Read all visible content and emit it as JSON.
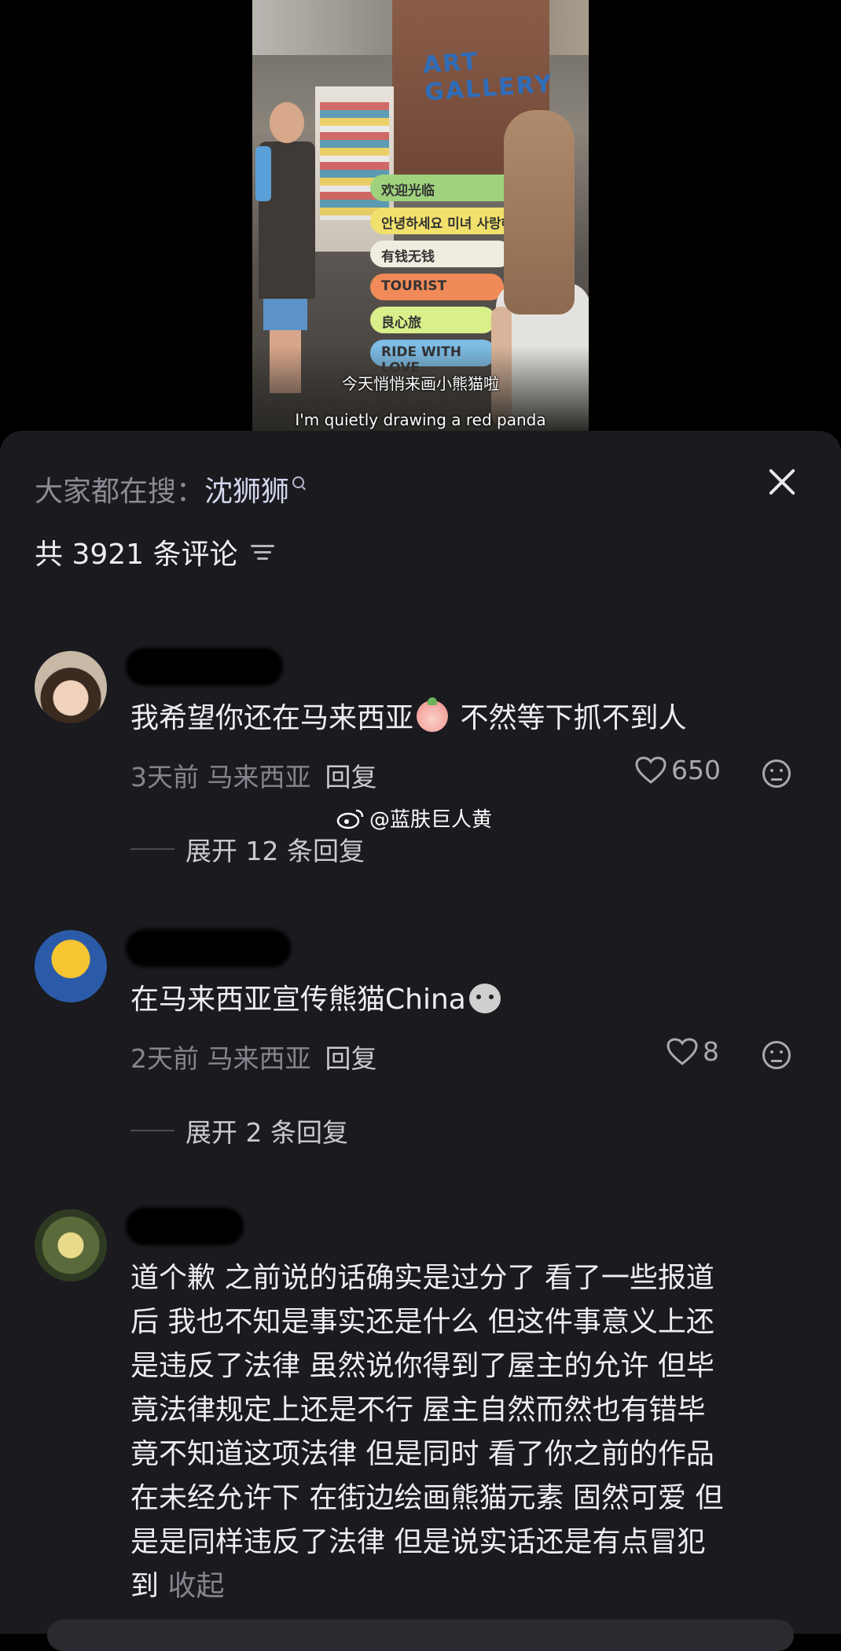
{
  "video": {
    "subtitle_cn": "今天悄悄来画小熊猫啦",
    "subtitle_en": "I'm quietly drawing a red panda",
    "wall_text": "ART GALLERY",
    "signs": [
      "欢迎光临",
      "안녕하세요 미녀 사랑해",
      "有钱无钱",
      "TOURIST",
      "良心旅",
      "RIDE WITH LOVE"
    ]
  },
  "header": {
    "search_prefix": "大家都在搜：",
    "search_keyword": "沈狮狮",
    "comment_count": "共 3921 条评论"
  },
  "comments": [
    {
      "text_before": "我希望你还在马来西亚",
      "text_after": " 不然等下抓不到人",
      "time_loc": "3天前 马来西亚",
      "reply": "回复",
      "likes": "650",
      "expand": "展开 12 条回复"
    },
    {
      "text": "在马来西亚宣传熊猫China",
      "time_loc": "2天前 马来西亚",
      "reply": "回复",
      "likes": "8",
      "expand": "展开 2 条回复"
    },
    {
      "lines": [
        "道个歉 之前说的话确实是过分了 看了一些报道",
        "后 我也不知是事实还是什么 但这件事意义上还",
        "是违反了法律 虽然说你得到了屋主的允许 但毕",
        "竟法律规定上还是不行 屋主自然而然也有错毕",
        "竟不知道这项法律 但是同时 看了你之前的作品",
        "在未经允许下 在街边绘画熊猫元素 固然可爱 但",
        "是是同样违反了法律 但是说实话还是有点冒犯"
      ],
      "last_line": "到",
      "collapse": "收起"
    }
  ],
  "watermark": "@蓝肤巨人黄",
  "colors": {
    "panel_bg": "#1a1a1f",
    "text": "#eeeef2",
    "meta": "#85858e"
  }
}
